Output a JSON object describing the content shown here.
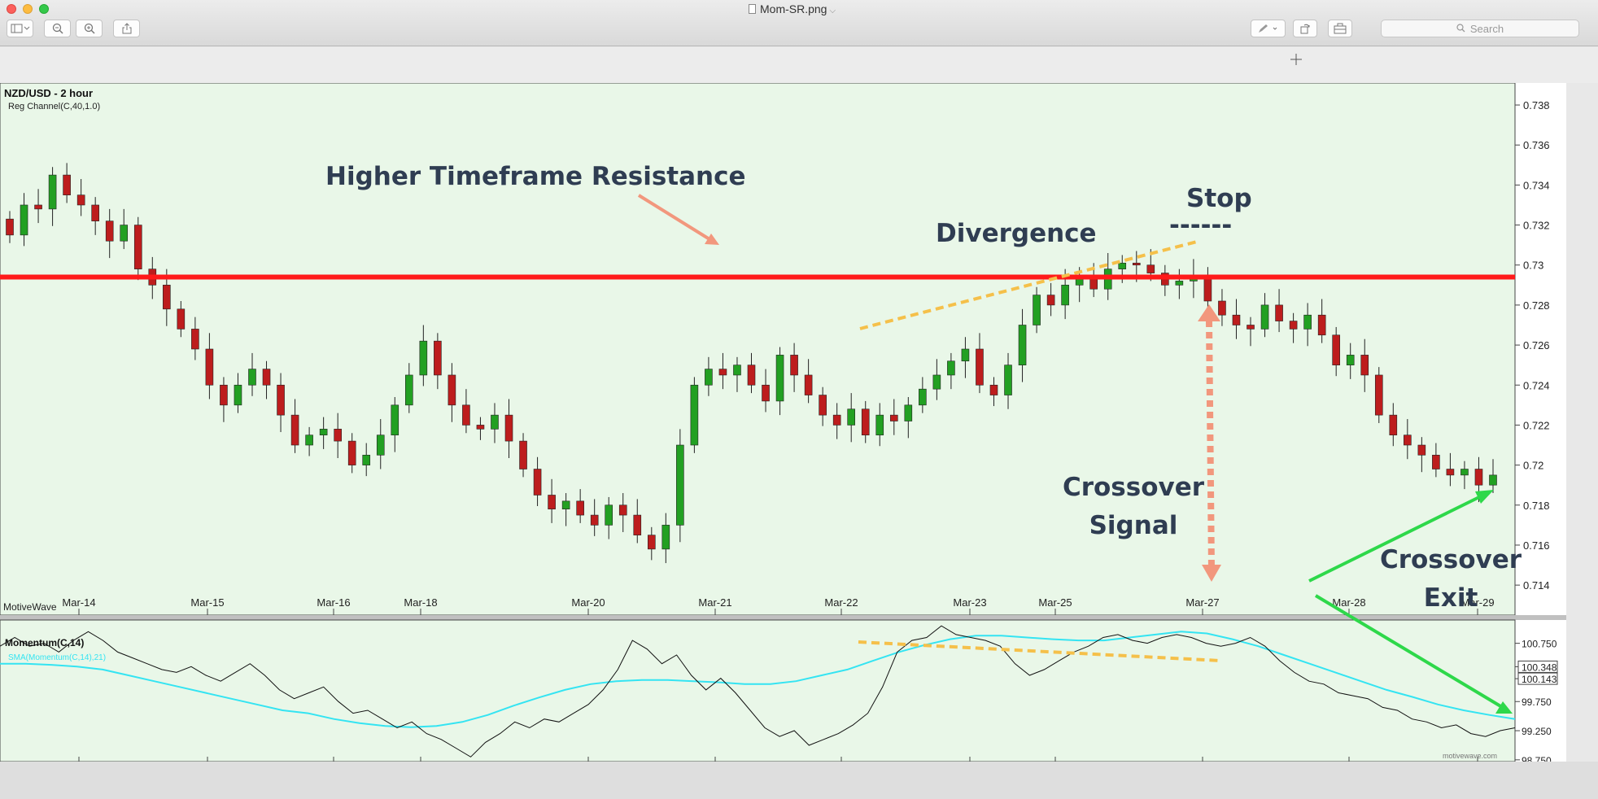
{
  "window": {
    "title": "Mom-SR.png",
    "search_placeholder": "Search"
  },
  "toolbar": {
    "zoom_out_icon": "zoom-out-icon",
    "zoom_in_icon": "zoom-in-icon",
    "share_icon": "share-icon",
    "markup_icon": "pen-icon",
    "rotate_icon": "rotate-icon",
    "toolbox_icon": "toolbox-icon",
    "sidebar_icon": "sidebar-icon"
  },
  "colors": {
    "panel_bg": "#e9f7e8",
    "up_candle": "#22a022",
    "down_candle": "#bd1d1d",
    "resistance": "#ff1a1a",
    "annotation_text": "#2f3d52",
    "arrow_orange": "#f2977d",
    "arrow_green": "#2ed84a",
    "dash_yellow": "#f5c04a",
    "sma_line": "#34e4f2"
  },
  "chart_data": {
    "type": "candlestick",
    "title": "NZD/USD - 2 hour",
    "indicator_label": "Reg Channel(C,40,1.0)",
    "watermark": "MotiveWave",
    "watermark_small": "motivewave.com",
    "x_tick_labels": [
      "Mar-14",
      "Mar-15",
      "Mar-16",
      "Mar-18",
      "Mar-20",
      "Mar-21",
      "Mar-22",
      "Mar-23",
      "Mar-25",
      "Mar-27",
      "Mar-28",
      "Mar-29"
    ],
    "y_tick_labels": [
      "0.738",
      "0.736",
      "0.734",
      "0.732",
      "0.73",
      "0.728",
      "0.726",
      "0.724",
      "0.722",
      "0.72",
      "0.718",
      "0.716",
      "0.714"
    ],
    "y_range": [
      0.7125,
      0.7391
    ],
    "resistance_level": 0.7294,
    "closes": [
      0.7315,
      0.733,
      0.7328,
      0.7345,
      0.7335,
      0.733,
      0.7322,
      0.7312,
      0.732,
      0.7298,
      0.729,
      0.7278,
      0.7268,
      0.7258,
      0.724,
      0.723,
      0.724,
      0.7248,
      0.724,
      0.7225,
      0.721,
      0.7215,
      0.7218,
      0.7212,
      0.72,
      0.7205,
      0.7215,
      0.723,
      0.7245,
      0.7262,
      0.7245,
      0.723,
      0.722,
      0.7218,
      0.7225,
      0.7212,
      0.7198,
      0.7185,
      0.7178,
      0.7182,
      0.7175,
      0.717,
      0.718,
      0.7175,
      0.7165,
      0.7158,
      0.717,
      0.721,
      0.724,
      0.7248,
      0.7245,
      0.725,
      0.724,
      0.7232,
      0.7255,
      0.7245,
      0.7235,
      0.7225,
      0.722,
      0.7228,
      0.7215,
      0.7225,
      0.7222,
      0.723,
      0.7238,
      0.7245,
      0.7252,
      0.7258,
      0.724,
      0.7235,
      0.725,
      0.727,
      0.7285,
      0.728,
      0.729,
      0.7295,
      0.7288,
      0.7298,
      0.7301,
      0.73,
      0.7296,
      0.729,
      0.7292,
      0.7295,
      0.7282,
      0.7275,
      0.727,
      0.7268,
      0.728,
      0.7272,
      0.7268,
      0.7275,
      0.7265,
      0.725,
      0.7255,
      0.7245,
      0.7225,
      0.7215,
      0.721,
      0.7205,
      0.7198,
      0.7195,
      0.7198,
      0.719,
      0.7195
    ],
    "momentum": {
      "label": "Momentum(C,14)",
      "sma_label": "SMA(Momentum(C,14),21)",
      "y_tick_labels": [
        "100.750",
        "100.348",
        "100.143",
        "99.750",
        "99.250",
        "98.750"
      ],
      "y_range": [
        98.72,
        101.15
      ],
      "line": [
        100.7,
        100.85,
        100.7,
        100.75,
        100.6,
        100.8,
        100.95,
        100.8,
        100.6,
        100.5,
        100.4,
        100.3,
        100.25,
        100.35,
        100.2,
        100.1,
        100.25,
        100.4,
        100.2,
        99.95,
        99.8,
        99.9,
        100.0,
        99.75,
        99.55,
        99.6,
        99.45,
        99.3,
        99.4,
        99.2,
        99.1,
        98.95,
        98.8,
        99.05,
        99.2,
        99.4,
        99.3,
        99.45,
        99.4,
        99.55,
        99.7,
        99.95,
        100.3,
        100.8,
        100.65,
        100.4,
        100.55,
        100.2,
        99.95,
        100.15,
        99.9,
        99.6,
        99.3,
        99.15,
        99.25,
        99.0,
        99.1,
        99.2,
        99.35,
        99.55,
        100.0,
        100.6,
        100.8,
        100.85,
        101.05,
        100.9,
        100.85,
        100.8,
        100.7,
        100.4,
        100.2,
        100.3,
        100.45,
        100.6,
        100.7,
        100.85,
        100.9,
        100.8,
        100.75,
        100.85,
        100.9,
        100.85,
        100.75,
        100.7,
        100.75,
        100.85,
        100.7,
        100.45,
        100.25,
        100.1,
        100.05,
        99.9,
        99.85,
        99.8,
        99.65,
        99.6,
        99.45,
        99.4,
        99.3,
        99.35,
        99.2,
        99.15,
        99.25,
        99.3
      ],
      "sma": [
        100.4,
        100.4,
        100.38,
        100.35,
        100.3,
        100.2,
        100.1,
        100.0,
        99.9,
        99.8,
        99.7,
        99.6,
        99.55,
        99.45,
        99.38,
        99.33,
        99.31,
        99.33,
        99.4,
        99.52,
        99.68,
        99.82,
        99.95,
        100.05,
        100.1,
        100.12,
        100.12,
        100.1,
        100.08,
        100.05,
        100.05,
        100.1,
        100.2,
        100.3,
        100.45,
        100.6,
        100.72,
        100.82,
        100.88,
        100.88,
        100.85,
        100.82,
        100.8,
        100.8,
        100.85,
        100.9,
        100.95,
        100.92,
        100.82,
        100.7,
        100.55,
        100.4,
        100.25,
        100.1,
        99.95,
        99.83,
        99.7,
        99.6,
        99.52,
        99.45
      ]
    },
    "annotations": {
      "resistance": "Higher Timeframe Resistance",
      "divergence": "Divergence",
      "stop": "Stop",
      "stop_dash": "------",
      "crossover_signal_1": "Crossover",
      "crossover_signal_2": "Signal",
      "crossover_exit_1": "Crossover",
      "crossover_exit_2": "Exit"
    }
  }
}
